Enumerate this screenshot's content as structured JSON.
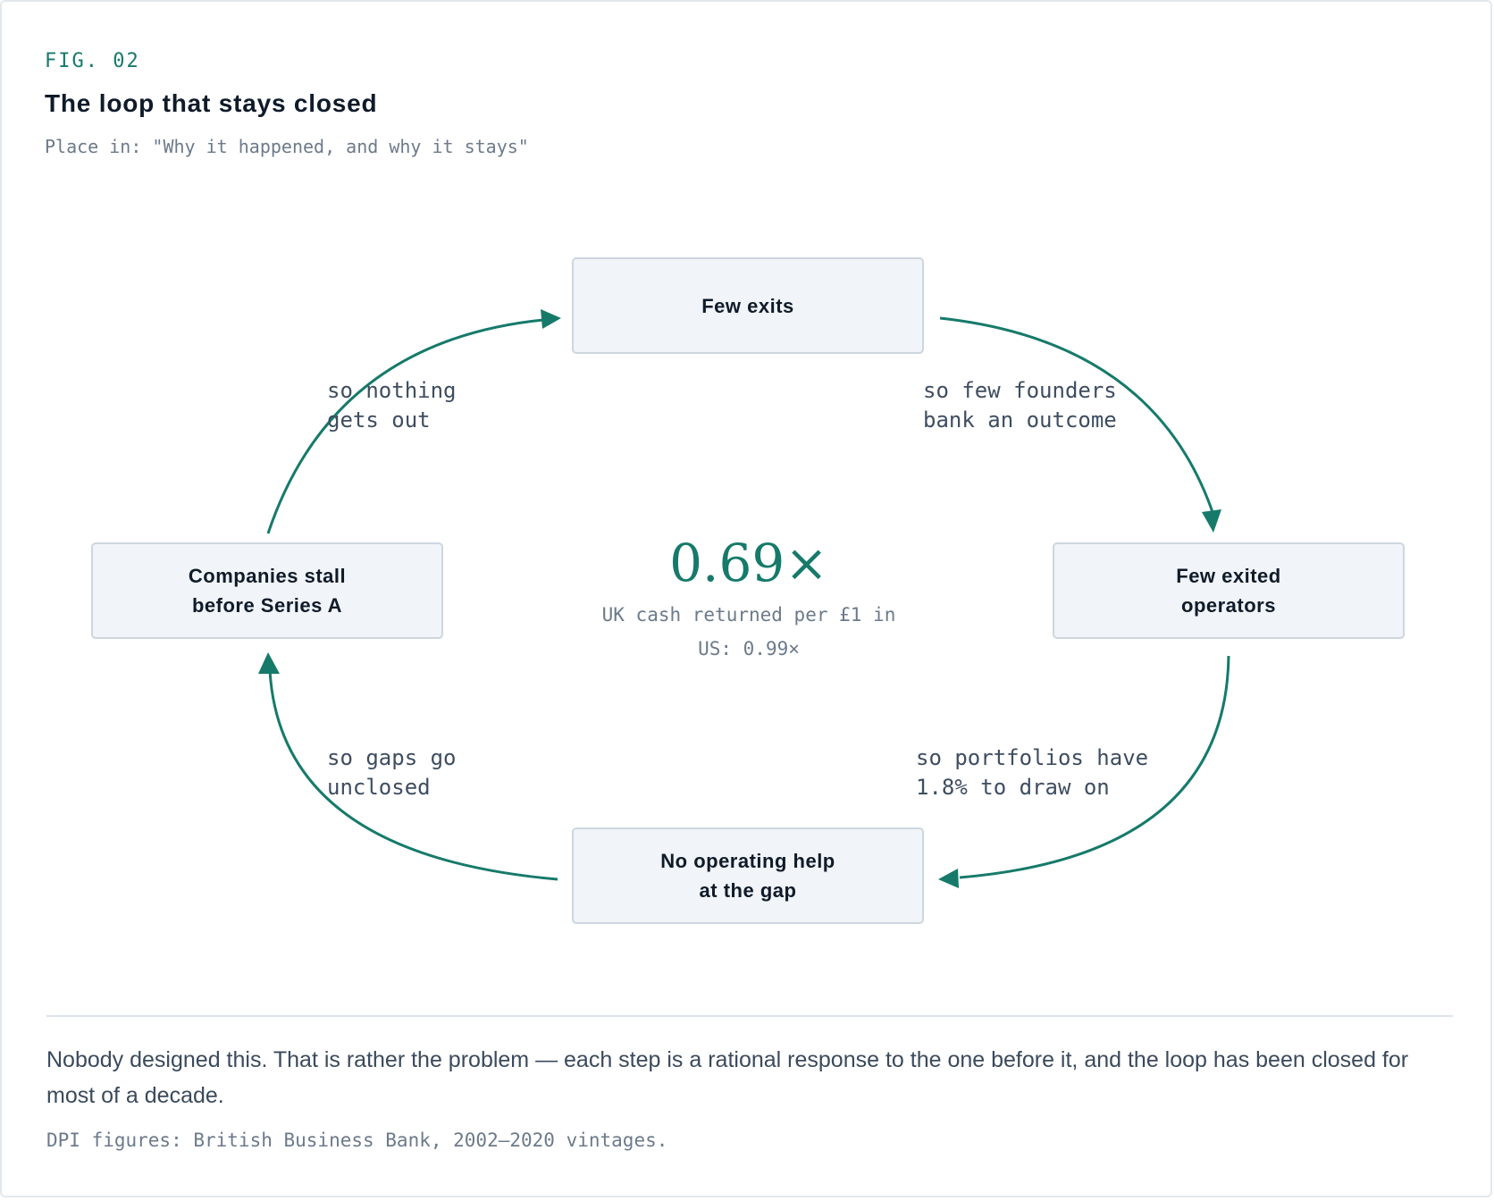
{
  "figure": {
    "label": "FIG. 02",
    "title": "The loop that stays closed",
    "placement": "Place in: \"Why it happened, and why it stays\""
  },
  "nodes": {
    "top": "Few exits",
    "right": "Few exited\noperators",
    "bottom": "No operating help\nat the gap",
    "left": "Companies stall\nbefore Series A"
  },
  "edges": {
    "top_right": "so few founders\nbank an outcome",
    "right_bottom": "so portfolios have\n1.8% to draw on",
    "bottom_left": "so gaps go\nunclosed",
    "left_top": "so nothing\ngets out"
  },
  "center": {
    "value": "0.69×",
    "caption": "UK cash returned per £1 in",
    "comparison": "US: 0.99×"
  },
  "footer": {
    "note": "Nobody designed this. That is rather the problem — each step is a rational response to the one before it, and the loop has been closed for most of a decade.",
    "source": "DPI figures: British Business Bank, 2002–2020 vintages."
  },
  "colors": {
    "accent": "#167a6a",
    "node_fill": "#f1f4f8",
    "node_border": "#cdd6e0",
    "text_dark": "#0f1b2a",
    "text_muted": "#6c7a8a"
  }
}
